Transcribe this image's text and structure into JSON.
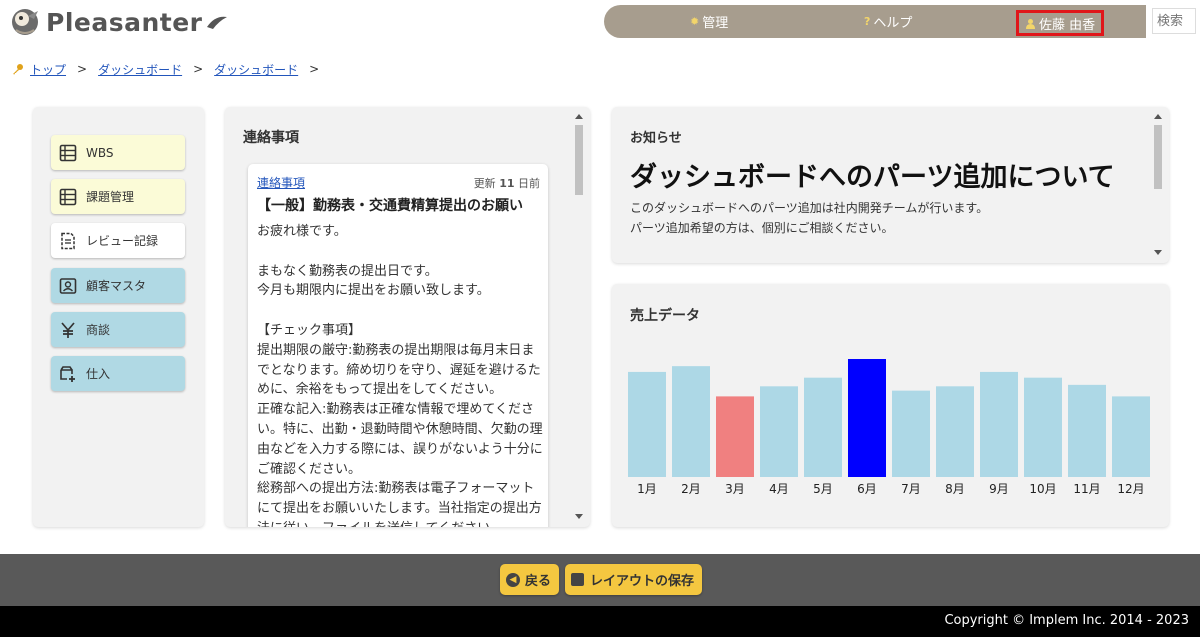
{
  "header": {
    "logo_text": "Pleasanter",
    "nav": [
      {
        "label": "管理",
        "icon": "gear-icon"
      },
      {
        "label": "ヘルプ",
        "icon": "question-icon"
      },
      {
        "label": "佐藤 由香",
        "icon": "user-icon"
      }
    ],
    "search_placeholder": "検索"
  },
  "breadcrumb": {
    "items": [
      "トップ",
      "ダッシュボード",
      "ダッシュボード"
    ],
    "separator": ">"
  },
  "sidebar": {
    "items": [
      {
        "label": "WBS",
        "icon": "table-icon",
        "style": "yellow"
      },
      {
        "label": "課題管理",
        "icon": "table-icon",
        "style": "yellow"
      },
      {
        "label": "レビュー記録",
        "icon": "document-icon",
        "style": "white"
      },
      {
        "label": "顧客マスタ",
        "icon": "contact-card-icon",
        "style": "blue"
      },
      {
        "label": "商談",
        "icon": "yen-icon",
        "style": "blue"
      },
      {
        "label": "仕入",
        "icon": "add-box-icon",
        "style": "blue"
      }
    ]
  },
  "messages": {
    "title": "連絡事項",
    "card": {
      "type": "連絡事項",
      "updated_prefix": "更新",
      "updated_value": "11",
      "updated_suffix": "日前",
      "title": "【一般】勤務表・交通費精算提出のお願い",
      "body": "お疲れ様です。\n\nまもなく勤務表の提出日です。\n今月も期限内に提出をお願い致します。\n\n【チェック事項】\n提出期限の厳守:勤務表の提出期限は毎月末日までとなります。締め切りを守り、遅延を避けるために、余裕をもって提出をしてください。\n正確な記入:勤務表は正確な情報で埋めてください。特に、出勤・退勤時間や休憩時間、欠勤の理由などを入力する際には、誤りがないよう十分にご確認ください。\n総務部への提出方法:勤務表は電子フォーマットにて提出をお願いいたします。当社指定の提出方法に従い、ファイルを送信してください。"
    }
  },
  "notice": {
    "label": "お知らせ",
    "headline": "ダッシュボードへのパーツ追加について",
    "lines": [
      "このダッシュボードへのパーツ追加は社内開発チームが行います。",
      "パーツ追加希望の方は、個別にご相談ください。"
    ]
  },
  "sales": {
    "title": "売上データ"
  },
  "chart_data": {
    "type": "bar",
    "title": "売上データ",
    "categories": [
      "1月",
      "2月",
      "3月",
      "4月",
      "5月",
      "6月",
      "7月",
      "8月",
      "9月",
      "10月",
      "11月",
      "12月"
    ],
    "values": [
      73,
      77,
      56,
      63,
      69,
      82,
      60,
      63,
      73,
      69,
      64,
      56
    ],
    "colors": [
      "#add8e6",
      "#add8e6",
      "#f08080",
      "#add8e6",
      "#add8e6",
      "#0000ff",
      "#add8e6",
      "#add8e6",
      "#add8e6",
      "#add8e6",
      "#add8e6",
      "#add8e6"
    ],
    "ylim": [
      0,
      100
    ],
    "grid": false,
    "legend": "none"
  },
  "footer": {
    "back_label": "戻る",
    "save_label": "レイアウトの保存",
    "copyright": "Copyright © Implem Inc. 2014 - 2023"
  },
  "colors": {
    "nav_bg": "#a79d8e",
    "footer_bg": "#595959",
    "button_yellow": "#f4c740",
    "highlight_red": "#e0161a"
  }
}
